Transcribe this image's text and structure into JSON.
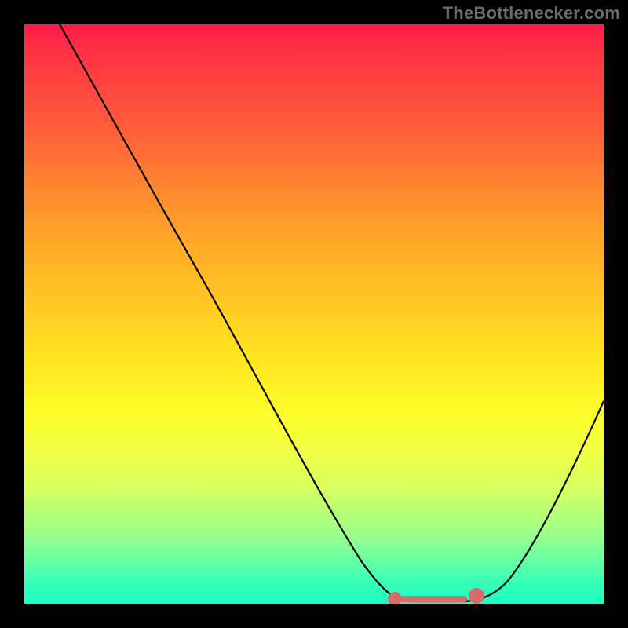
{
  "attribution": "TheBottlenecker.com",
  "chart_data": {
    "type": "line",
    "title": "",
    "xlabel": "",
    "ylabel": "",
    "xlim": [
      0,
      100
    ],
    "ylim": [
      0,
      100
    ],
    "series": [
      {
        "name": "bottleneck-curve",
        "x": [
          0,
          5,
          10,
          15,
          20,
          25,
          30,
          35,
          40,
          45,
          50,
          55,
          60,
          63,
          66,
          70,
          73,
          76,
          80,
          85,
          90,
          95,
          100
        ],
        "y": [
          100,
          92,
          84,
          76,
          68,
          60,
          52,
          44,
          36,
          28,
          20,
          12,
          6,
          2,
          0.5,
          0,
          0,
          0.5,
          2,
          7,
          18,
          32,
          48
        ]
      },
      {
        "name": "optimal-marker",
        "x": [
          63,
          66,
          70,
          73,
          76,
          78
        ],
        "y": [
          0.7,
          0.5,
          0.5,
          0.5,
          0.7,
          1.2
        ]
      }
    ],
    "style": {
      "background_gradient_top": "#ff1a49",
      "background_gradient_bottom": "#1affc6",
      "curve_color": "#000000",
      "marker_color": "#d86b6b"
    }
  }
}
